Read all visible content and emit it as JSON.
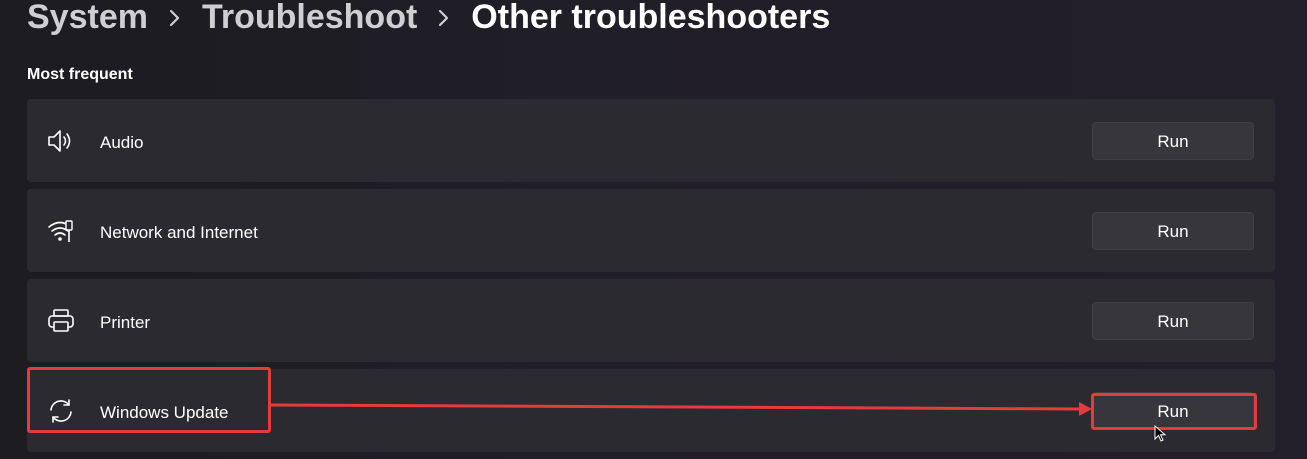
{
  "breadcrumb": {
    "items": [
      "System",
      "Troubleshoot",
      "Other troubleshooters"
    ],
    "separator_icon": "chevron-right-icon"
  },
  "section": {
    "title": "Most frequent"
  },
  "troubleshooters": [
    {
      "label": "Audio",
      "icon": "speaker-icon",
      "button_label": "Run"
    },
    {
      "label": "Network and Internet",
      "icon": "wifi-icon",
      "button_label": "Run"
    },
    {
      "label": "Printer",
      "icon": "printer-icon",
      "button_label": "Run"
    },
    {
      "label": "Windows Update",
      "icon": "sync-icon",
      "button_label": "Run"
    }
  ],
  "annotation": {
    "color": "#e23c3c",
    "highlighted_item": "Windows Update"
  },
  "colors": {
    "background": "#1f1d25",
    "card": "#2b2a31",
    "button": "#37363c",
    "text": "#ffffff"
  }
}
